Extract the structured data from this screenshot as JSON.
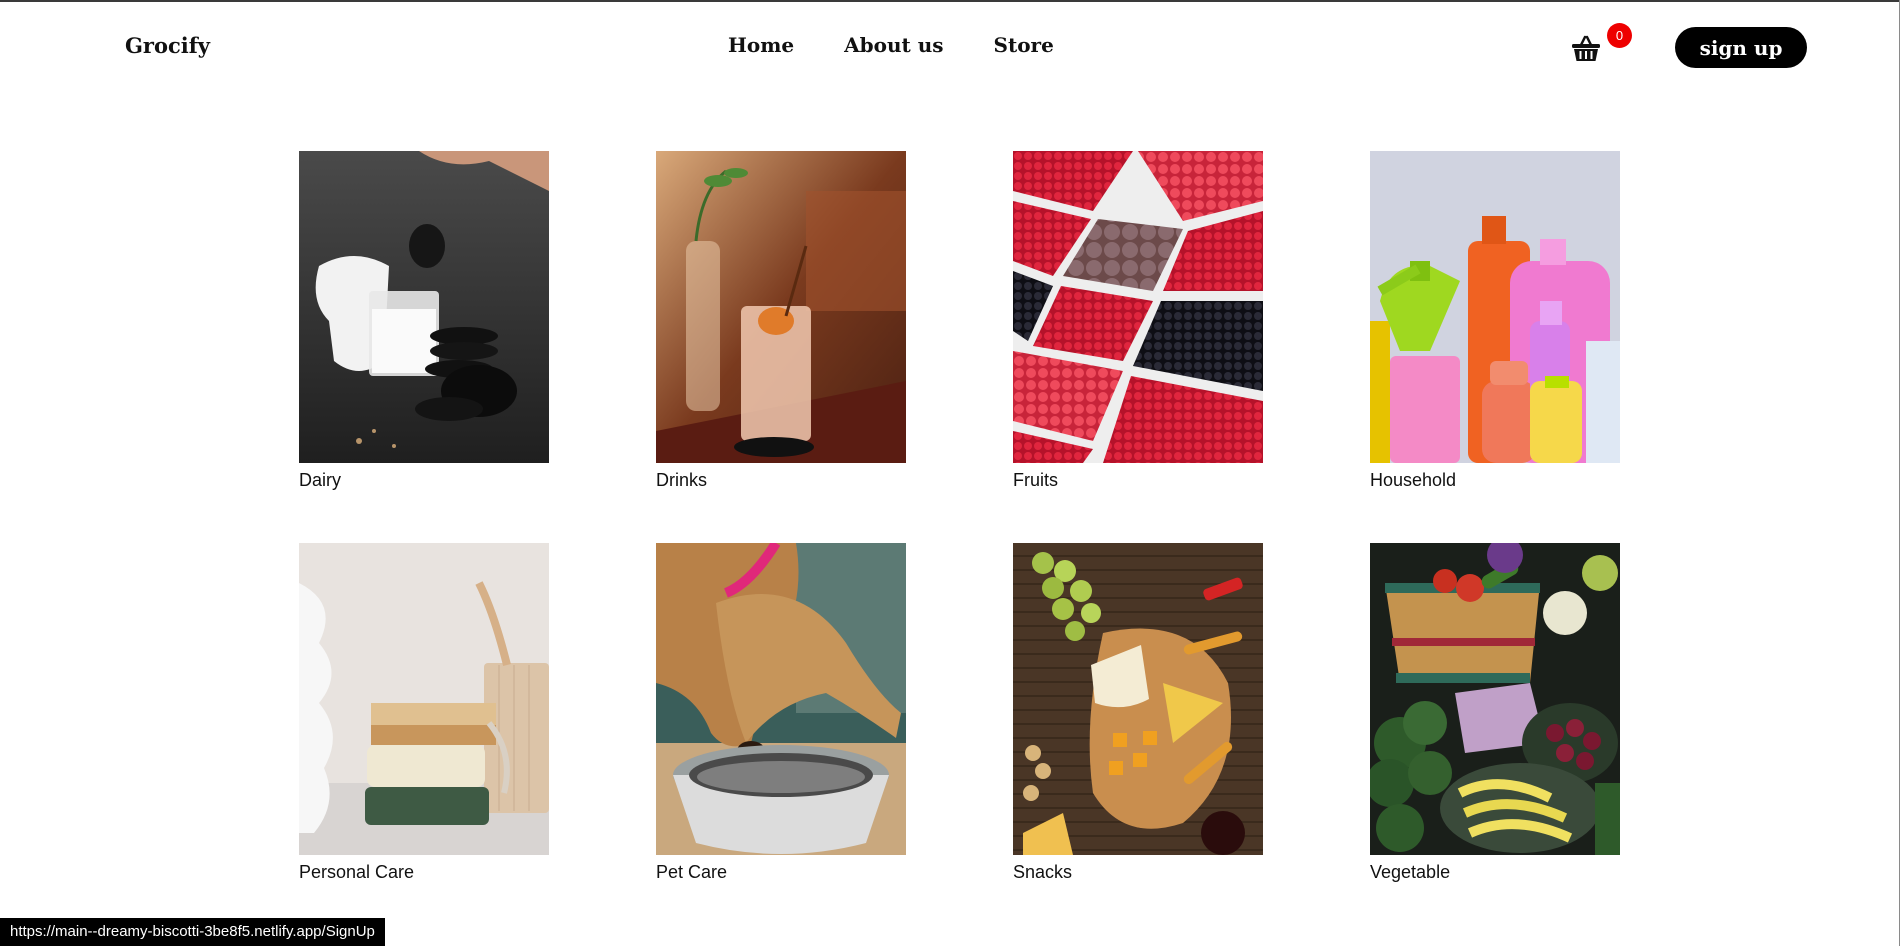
{
  "header": {
    "brand": "Grocify",
    "nav": [
      "Home",
      "About us",
      "Store"
    ],
    "cart_count": "0",
    "signup_label": "sign up"
  },
  "categories": [
    {
      "label": "Dairy",
      "icon": "dairy-image"
    },
    {
      "label": "Drinks",
      "icon": "drinks-image"
    },
    {
      "label": "Fruits",
      "icon": "fruits-image"
    },
    {
      "label": "Household",
      "icon": "household-image"
    },
    {
      "label": "Personal Care",
      "icon": "personal-care-image"
    },
    {
      "label": "Pet Care",
      "icon": "pet-care-image"
    },
    {
      "label": "Snacks",
      "icon": "snacks-image"
    },
    {
      "label": "Vegetable",
      "icon": "vegetable-image"
    }
  ],
  "status_bar": {
    "url": "https://main--dreamy-biscotti-3be8f5.netlify.app/SignUp"
  }
}
